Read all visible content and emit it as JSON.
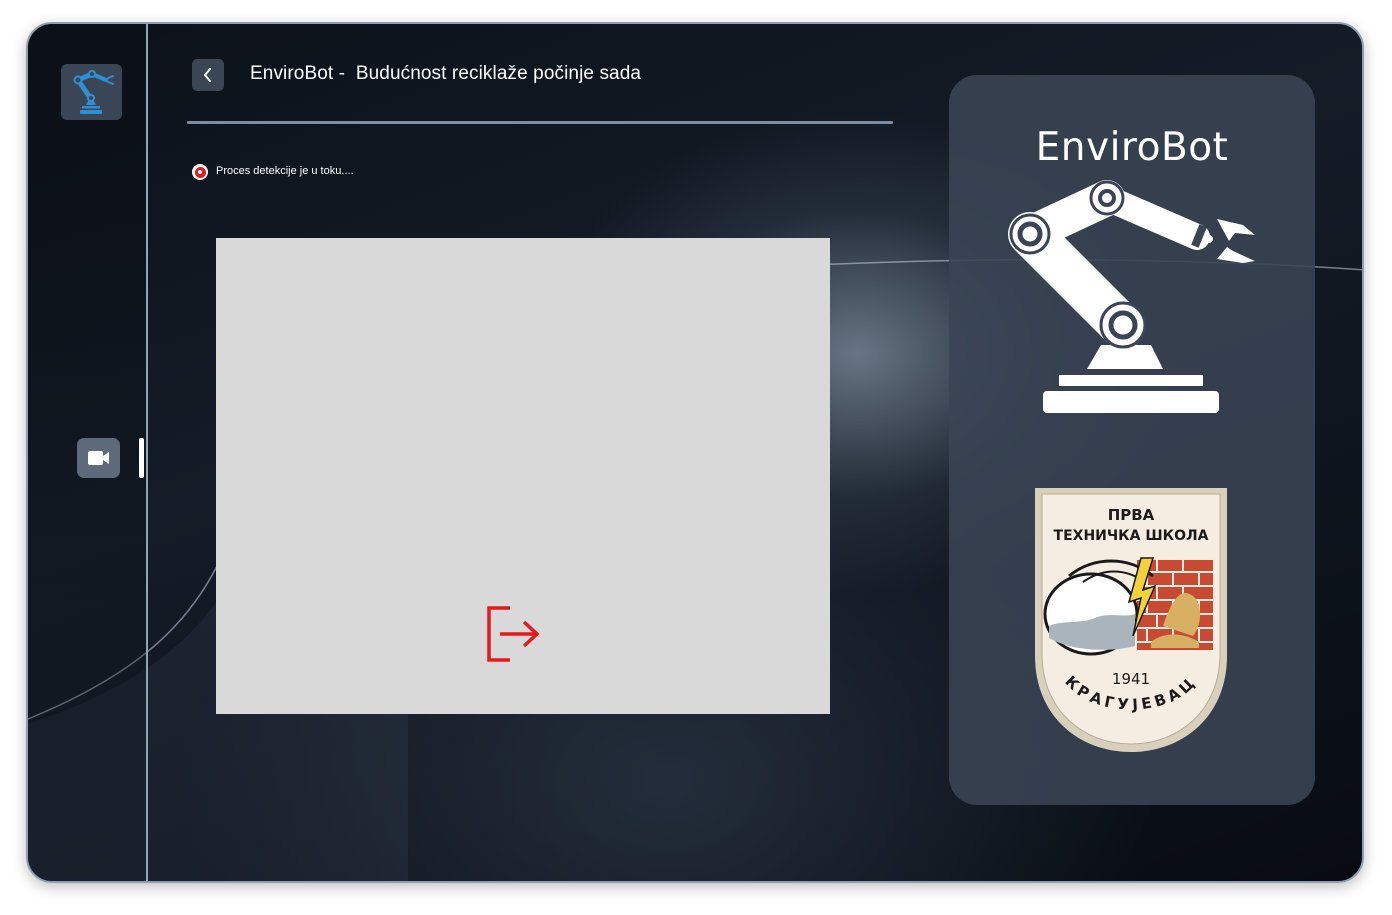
{
  "header": {
    "title": "EnviroBot -  Budućnost reciklaže počinje sada"
  },
  "sidebar": {
    "logo_icon": "robot-arm-icon",
    "items": [
      {
        "icon": "video-camera-icon",
        "active": true
      }
    ]
  },
  "status": {
    "text": "Proces detekcije je u toku....",
    "indicator_color": "#e31b1b"
  },
  "video_area": {
    "action_icon": "exit-icon",
    "action_color": "#e31b1b"
  },
  "right_panel": {
    "brand_title": "EnviroBot",
    "school_logo": {
      "line1": "ПРВА",
      "line2": "ТЕХНИЧКА ШКОЛА",
      "year": "1941",
      "city": "КРАГУЈЕВАЦ"
    }
  },
  "colors": {
    "accent": "#2f8fd6",
    "panel": "#3a4454",
    "background": "#0e141d",
    "alert": "#e31b1b"
  }
}
